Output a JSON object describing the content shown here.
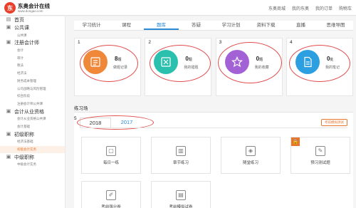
{
  "header": {
    "logo_mark": "东",
    "logo_name": "东奥会计在线",
    "logo_url": "www.dongao.com",
    "nav": [
      "东奥商城",
      "我的东奥",
      "我的订单",
      "购物车"
    ]
  },
  "sidebar": {
    "rows": [
      {
        "type": "cat",
        "icon": "▤",
        "label": "首页"
      },
      {
        "type": "cat",
        "icon": "▣",
        "label": "公共课"
      },
      {
        "type": "sub",
        "label": "公共课"
      },
      {
        "type": "cat",
        "icon": "▣",
        "label": "注册会计师"
      },
      {
        "type": "sub",
        "label": "会计"
      },
      {
        "type": "sub",
        "label": "审计"
      },
      {
        "type": "sub",
        "label": "税法"
      },
      {
        "type": "sub",
        "label": "经济法"
      },
      {
        "type": "sub",
        "label": "财务成本管理"
      },
      {
        "type": "sub",
        "label": "公司战略与风险管理"
      },
      {
        "type": "sub",
        "label": "综合阶段"
      },
      {
        "type": "sub",
        "label": "注册会计师公共课"
      },
      {
        "type": "cat",
        "icon": "▣",
        "label": "会计从业资格"
      },
      {
        "type": "sub",
        "label": "会计从业资格公共课"
      },
      {
        "type": "sub",
        "label": "会计基础"
      },
      {
        "type": "cat",
        "icon": "▣",
        "label": "初级职称"
      },
      {
        "type": "sub",
        "label": "经济法基础"
      },
      {
        "type": "sub",
        "label": "初级会计实务",
        "active": true
      },
      {
        "type": "cat",
        "icon": "▣",
        "label": "中级职称"
      },
      {
        "type": "sub",
        "label": "中级会计实务"
      }
    ]
  },
  "tabs": [
    {
      "label": "学习统计"
    },
    {
      "label": "课程"
    },
    {
      "label": "题库",
      "active": true
    },
    {
      "label": "答疑"
    },
    {
      "label": "学习计划"
    },
    {
      "label": "资料下载"
    },
    {
      "label": "直播"
    },
    {
      "label": "思维导图"
    }
  ],
  "cards": [
    {
      "num": "1",
      "count": "8",
      "unit": "题",
      "label": "做题记录",
      "color": "#f0883a",
      "icon": "list-icon"
    },
    {
      "num": "2",
      "count": "0",
      "unit": "题",
      "label": "我的错题",
      "color": "#2bbfae",
      "icon": "wrong-icon"
    },
    {
      "num": "3",
      "count": "0",
      "unit": "题",
      "label": "我的收藏",
      "color": "#a262d6",
      "icon": "star-icon"
    },
    {
      "num": "4",
      "count": "0",
      "unit": "处",
      "label": "我的笔记",
      "color": "#2b9fe0",
      "icon": "note-icon"
    }
  ],
  "practice": {
    "title": "练习场",
    "num": "5",
    "years": [
      "2018",
      "2017"
    ],
    "mock_button": "考前模拟测试",
    "tiles": [
      {
        "label": "每日一练",
        "icon": "calendar-icon",
        "glyph": "▢"
      },
      {
        "label": "章节练习",
        "icon": "book-icon",
        "glyph": "▥"
      },
      {
        "label": "随堂练习",
        "icon": "layers-icon",
        "glyph": "◈"
      },
      {
        "label": "预习测试题",
        "icon": "edit-icon",
        "glyph": "✎",
        "badge": "🔒"
      },
      {
        "label": "考前强分卷",
        "icon": "pencil-icon",
        "glyph": "✐"
      },
      {
        "label": "考前模拟试卷",
        "icon": "paper-icon",
        "glyph": "▤"
      }
    ]
  }
}
